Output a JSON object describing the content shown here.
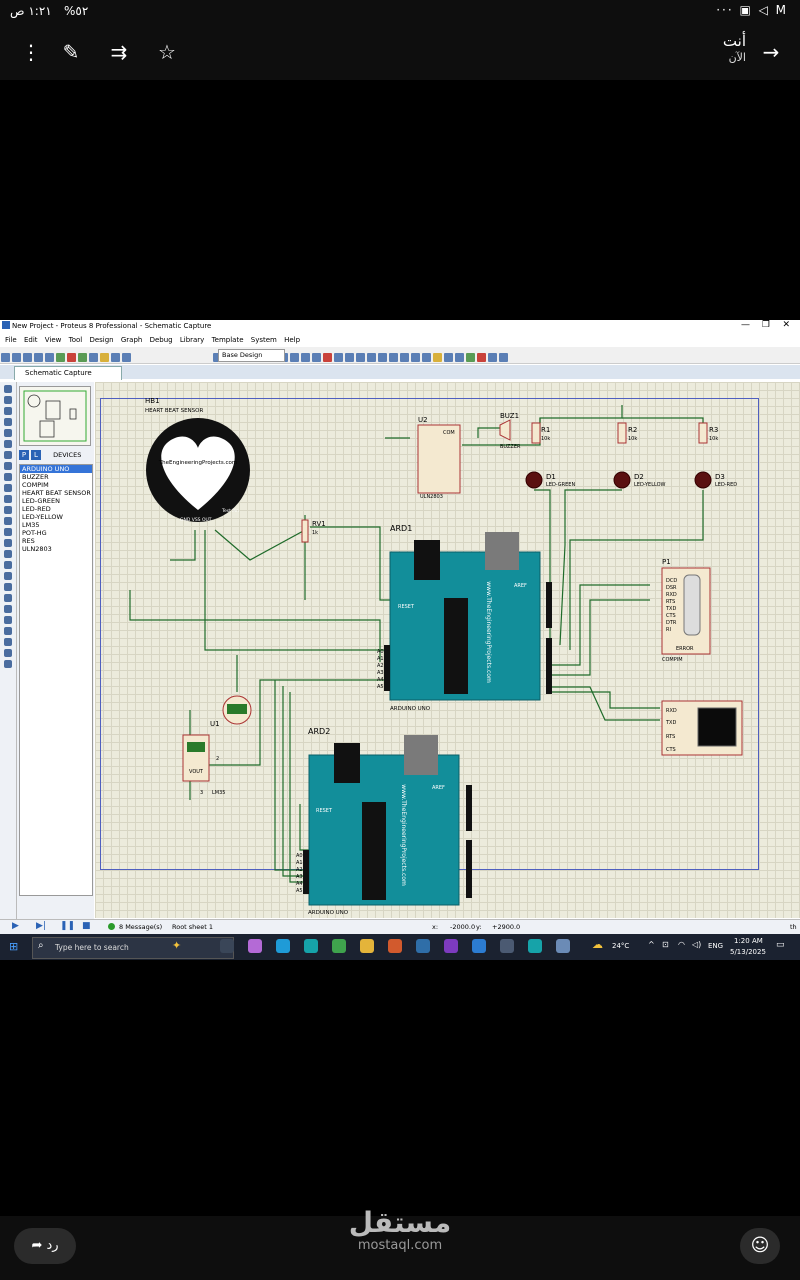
{
  "status_bar": {
    "time": "١:٢١ ص",
    "battery": "%٥٢",
    "right_icons": "··· ▣ ◁ M"
  },
  "phone_header": {
    "sender_name": "أنت",
    "sender_time": "الآن"
  },
  "app": {
    "window_title": "New Project - Proteus 8 Professional - Schematic Capture",
    "menu": [
      "File",
      "Edit",
      "View",
      "Tool",
      "Design",
      "Graph",
      "Debug",
      "Library",
      "Template",
      "System",
      "Help"
    ],
    "design_select": "Base Design",
    "tab_label": "Schematic Capture",
    "devices_header": "DEVICES",
    "devices": [
      "ARDUINO UNO",
      "BUZZER",
      "COMPIM",
      "HEART BEAT SENSOR",
      "LED-GREEN",
      "LED-RED",
      "LED-YELLOW",
      "LM35",
      "POT-HG",
      "RES",
      "ULN2803"
    ],
    "selected_device": "ARDUINO UNO",
    "status": {
      "messages": "8 Message(s)",
      "sheet": "Root sheet 1",
      "x_label": "x:",
      "x_value": "-2000.0",
      "y_label": "y:",
      "y_value": "+2900.0",
      "unit": "th"
    }
  },
  "schematic": {
    "hb1": {
      "ref": "HB1",
      "name": "HEART BEAT SENSOR",
      "site": "TheEngineeringProjects.com",
      "side": "Heart Beat Sensor",
      "test": "Test Pin",
      "pins": "GND VSS OUT"
    },
    "rv1": {
      "ref": "RV1",
      "value": "1k"
    },
    "u2": {
      "ref": "U2",
      "part": "ULN2803",
      "com": "COM"
    },
    "buz1": {
      "ref": "BUZ1",
      "part": "BUZZER"
    },
    "resistors": [
      {
        "ref": "R1",
        "value": "10k"
      },
      {
        "ref": "R2",
        "value": "10k"
      },
      {
        "ref": "R3",
        "value": "10k"
      }
    ],
    "leds": [
      {
        "ref": "D1",
        "part": "LED-GREEN"
      },
      {
        "ref": "D2",
        "part": "LED-YELLOW"
      },
      {
        "ref": "D3",
        "part": "LED-RED"
      }
    ],
    "ard1": {
      "ref": "ARD1",
      "part": "ARDUINO UNO",
      "site": "www.TheEngineeringProjects.com",
      "reset": "RESET",
      "aref": "AREF"
    },
    "ard2": {
      "ref": "ARD2",
      "part": "ARDUINO UNO",
      "site": "www.TheEngineeringProjects.com",
      "reset": "RESET",
      "aref": "AREF"
    },
    "p1": {
      "ref": "P1",
      "part": "COMPIM",
      "pins": [
        "DCD",
        "DSR",
        "RXD",
        "RTS",
        "TXD",
        "CTS",
        "DTR",
        "RI"
      ],
      "error": "ERROR"
    },
    "u1": {
      "ref": "U1",
      "part": "LM35",
      "vout": "VOUT",
      "pin3": "3",
      "pin2": "2"
    },
    "terminal": {
      "pins": [
        "RXD",
        "TXD",
        "RTS",
        "CTS"
      ]
    },
    "analog_pins": [
      "A0",
      "A1",
      "A2",
      "A3",
      "A4",
      "A5"
    ]
  },
  "taskbar": {
    "search_placeholder": "Type here to search",
    "temperature": "24°C",
    "language": "ENG",
    "clock_time": "1:20 AM",
    "clock_date": "5/13/2025"
  },
  "bottom": {
    "reply_label": "رد",
    "brand_ar": "مستقل",
    "brand_en": "mostaql.com"
  }
}
